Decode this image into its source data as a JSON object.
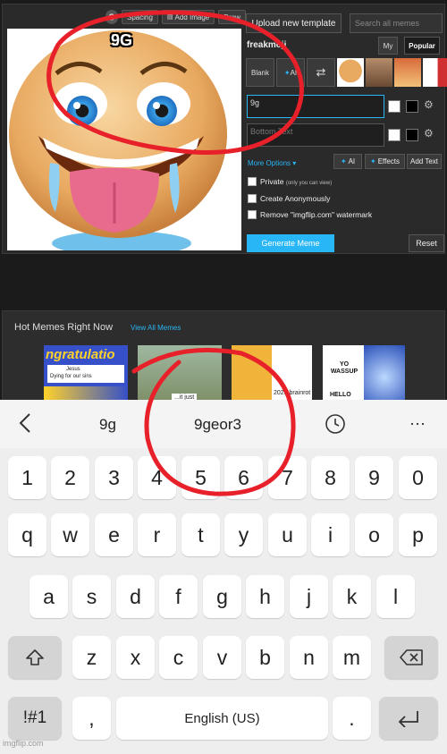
{
  "editor": {
    "toolbar": {
      "spacing_label": "Spacing",
      "add_image_label": "Add Image",
      "draw_label": "Draw"
    },
    "upload_label": "Upload new template",
    "search_placeholder": "Search all memes",
    "template_name": "freakmoji",
    "tabs": {
      "my": "My",
      "popular": "Popular"
    },
    "template_buttons": {
      "blank": "Blank",
      "ai": "AI"
    },
    "top_text_value": "9g",
    "bottom_text_placeholder": "Bottom Text",
    "more_options_label": "More Options",
    "ai_button_label": "AI",
    "effects_button_label": "Effects",
    "add_text_label": "Add Text",
    "private_label": "Private",
    "private_note": "(only you can view)",
    "anonymous_label": "Create Anonymously",
    "watermark_label": "Remove \"imgflip.com\" watermark",
    "generate_label": "Generate Meme",
    "reset_label": "Reset",
    "meme_caption": "9G"
  },
  "hot_memes": {
    "title": "Hot Memes Right Now",
    "view_all_label": "View All Memes",
    "thumb1_text": "ngratulatio",
    "thumb1_sub": "Jesus",
    "thumb1_sub2": "Dying for our sins",
    "thumb2_text": "...it just",
    "thumb3_text": "2025 brainrot",
    "thumb4_text1": "YO",
    "thumb4_text2": "WASSUP",
    "thumb4_text3": "HELLO"
  },
  "keyboard": {
    "suggestions": [
      "9g",
      "9geor3"
    ],
    "number_row": [
      "1",
      "2",
      "3",
      "4",
      "5",
      "6",
      "7",
      "8",
      "9",
      "0"
    ],
    "row1": [
      "q",
      "w",
      "e",
      "r",
      "t",
      "y",
      "u",
      "i",
      "o",
      "p"
    ],
    "row2": [
      "a",
      "s",
      "d",
      "f",
      "g",
      "h",
      "j",
      "k",
      "l"
    ],
    "row3": [
      "z",
      "x",
      "c",
      "v",
      "b",
      "n",
      "m"
    ],
    "symbols_label": "!#1",
    "comma_label": ",",
    "space_label": "English (US)",
    "period_label": "."
  },
  "watermark": "imgflip.com",
  "colors": {
    "accent": "#29b6f6",
    "annotation": "#e8202a"
  }
}
